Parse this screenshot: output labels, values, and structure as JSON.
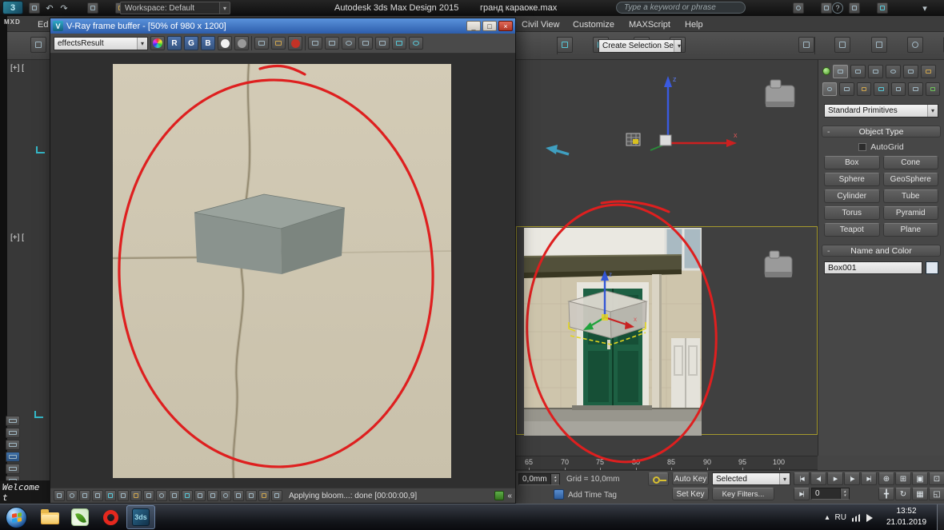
{
  "app": {
    "logo": "MXD",
    "workspace": "Workspace: Default",
    "title": "Autodesk 3ds Max Design 2015",
    "document": "гранд караоке.max",
    "search_placeholder": "Type a keyword or phrase"
  },
  "menubar": {
    "edit_fragment": "Ed",
    "items": [
      "Civil View",
      "Customize",
      "MAXScript",
      "Help"
    ]
  },
  "main_toolbar": {
    "selection_set": "Create Selection Se"
  },
  "vfb": {
    "title": "V-Ray frame buffer - [50% of 980 x 1200]",
    "channel_dropdown": "effectsResult",
    "channel_r": "R",
    "channel_g": "G",
    "channel_b": "B",
    "status": "Applying bloom...: done [00:00:00,9]"
  },
  "viewport": {
    "label_top": "[+] [",
    "label_bottom": "[+] [",
    "axis": {
      "z": "z",
      "x": "x"
    }
  },
  "command_panel": {
    "category": "Standard Primitives",
    "object_type": "Object Type",
    "autogrid": "AutoGrid",
    "primitives": [
      "Box",
      "Cone",
      "Sphere",
      "GeoSphere",
      "Cylinder",
      "Tube",
      "Torus",
      "Pyramid",
      "Teapot",
      "Plane"
    ],
    "name_and_color": "Name and Color",
    "object_name": "Box001"
  },
  "timeline": {
    "ticks": [
      "65",
      "70",
      "75",
      "80",
      "85",
      "90",
      "95",
      "100"
    ]
  },
  "status_bar": {
    "coordinate": "0,0mm",
    "grid": "Grid = 10,0mm",
    "add_time_tag": "Add Time Tag",
    "auto_key": "Auto Key",
    "set_key": "Set Key",
    "selection": "Selected",
    "key_filters": "Key Filters...",
    "frame": "0"
  },
  "welcome": {
    "text": "Welcome t"
  },
  "taskbar": {
    "lang": "RU",
    "time": "13:52",
    "date": "21.01.2019"
  },
  "icons": {
    "app_badge": "3",
    "vray": "V",
    "undo": "↶",
    "redo": "↷",
    "dropdown": "▾",
    "help": "?",
    "minimize": "_",
    "maximize": "□",
    "close": "×",
    "minus": "-",
    "collapse": "«",
    "max_badge": "3ds",
    "tray_arrow": "▴",
    "transport": [
      "|◀",
      "◀|",
      "▶",
      "|▶",
      "▶|"
    ],
    "frame_fwd": "▶|",
    "nav": [
      "⊕",
      "⊞",
      "▣",
      "⊡",
      "╋",
      "↻",
      "▦",
      "◱"
    ],
    "spin_up": "▴",
    "spin_down": "▾"
  }
}
